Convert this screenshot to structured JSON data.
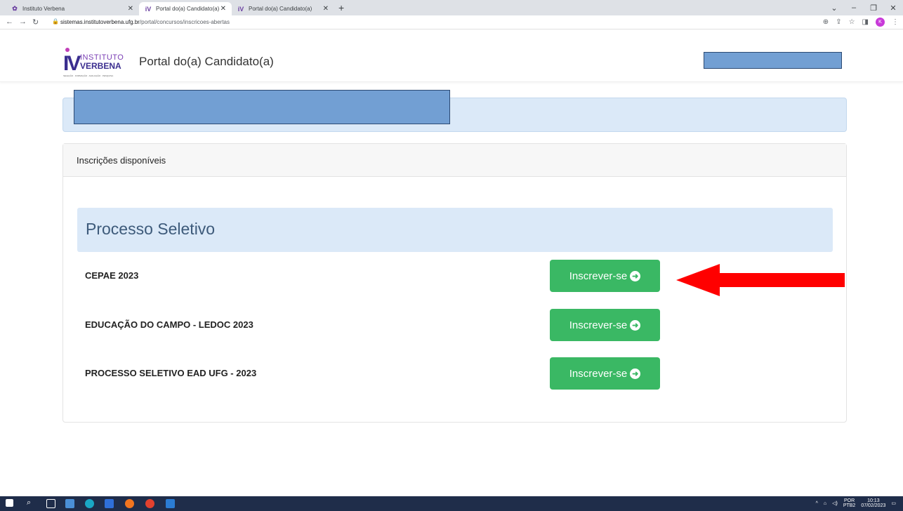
{
  "browser": {
    "tabs": [
      {
        "title": "Instituto Verbena",
        "active": false
      },
      {
        "title": "Portal do(a) Candidato(a)",
        "active": true
      },
      {
        "title": "Portal do(a) Candidato(a)",
        "active": false
      }
    ],
    "url_host": "sistemas.institutoverbena.ufg.br",
    "url_path": "/portal/concursos/inscricoes-abertas",
    "profile_initial": "K"
  },
  "header": {
    "logo_iv": "IV",
    "logo_institute": "INSTITUTO",
    "logo_verbena": "VERBENA",
    "logo_tagline": "SELEÇÃO · FORMAÇÃO · AVALIAÇÃO · PESQUISA",
    "title": "Portal do(a) Candidato(a)"
  },
  "card": {
    "header": "Inscrições disponíveis",
    "group_title": "Processo Seletivo",
    "items": [
      {
        "name": "CEPAE 2023",
        "button": "Inscrever-se"
      },
      {
        "name": "EDUCAÇÃO DO CAMPO - LEDOC 2023",
        "button": "Inscrever-se"
      },
      {
        "name": "PROCESSO SELETIVO EAD UFG - 2023",
        "button": "Inscrever-se"
      }
    ]
  },
  "taskbar": {
    "lang1": "POR",
    "lang2": "PTB2",
    "time": "10:13",
    "date": "07/02/2023"
  },
  "colors": {
    "accent_green": "#3ab864",
    "alert_bg": "#dbe9f8",
    "redaction": "#729fd3",
    "annotation_arrow": "#ff0000"
  }
}
